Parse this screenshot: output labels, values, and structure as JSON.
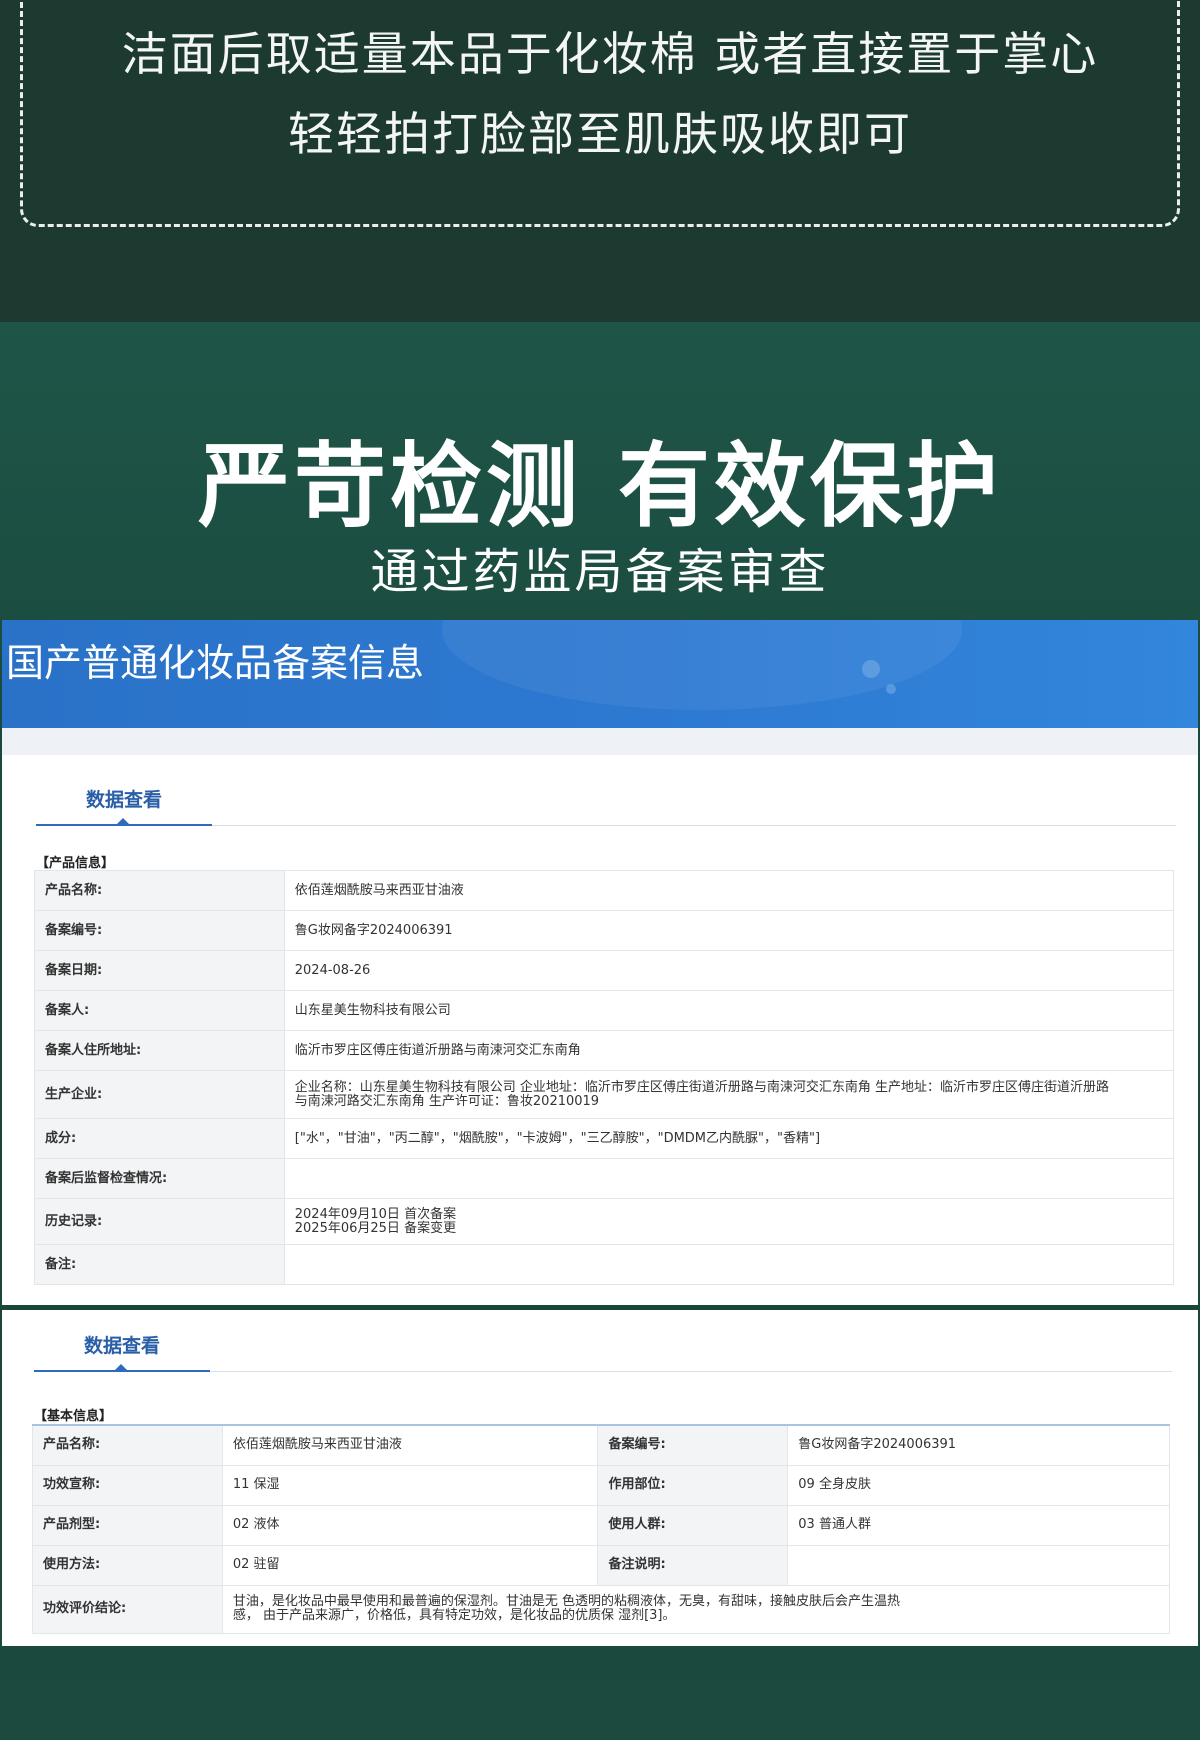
{
  "usage": {
    "line1": "洁面后取适量本品于化妆棉 或者直接置于掌心",
    "line2": "轻轻拍打脸部至肌肤吸收即可"
  },
  "inspection": {
    "title": "严苛检测 有效保护",
    "subtitle": "通过药监局备案审查"
  },
  "registry": {
    "banner_title": "国产普通化妆品备案信息",
    "tab_label": "数据查看",
    "product_section": "【产品信息】",
    "product_rows": [
      {
        "label": "产品名称:",
        "value": "依佰莲烟酰胺马来西亚甘油液"
      },
      {
        "label": "备案编号:",
        "value": "鲁G妆网备字2024006391"
      },
      {
        "label": "备案日期:",
        "value": "2024-08-26"
      },
      {
        "label": "备案人:",
        "value": "山东星美生物科技有限公司"
      },
      {
        "label": "备案人住所地址:",
        "value": "临沂市罗庄区傅庄街道沂册路与南涑河交汇东南角"
      },
      {
        "label": "生产企业:",
        "value": "企业名称：山东星美生物科技有限公司 企业地址：临沂市罗庄区傅庄街道沂册路与南涑河交汇东南角 生产地址：临沂市罗庄区傅庄街道沂册路与南涑河路交汇东南角 生产许可证：鲁妆20210019"
      },
      {
        "label": "成分:",
        "value": "[\"水\"，\"甘油\"，\"丙二醇\"，\"烟酰胺\"，\"卡波姆\"，\"三乙醇胺\"，\"DMDM乙内酰脲\"，\"香精\"]"
      },
      {
        "label": "备案后监督检查情况:",
        "value": ""
      },
      {
        "label": "历史记录:",
        "value_line1": "2024年09月10日 首次备案",
        "value_line2": "2025年06月25日 备案变更"
      },
      {
        "label": "备注:",
        "value": ""
      }
    ]
  },
  "registry2": {
    "tab_label": "数据查看",
    "basic_section": "【基本信息】",
    "rows": [
      {
        "k1": "产品名称:",
        "v1": "依佰莲烟酰胺马来西亚甘油液",
        "k2": "备案编号:",
        "v2": "鲁G妆网备字2024006391"
      },
      {
        "k1": "功效宣称:",
        "v1": "11 保湿",
        "k2": "作用部位:",
        "v2": "09 全身皮肤"
      },
      {
        "k1": "产品剂型:",
        "v1": "02 液体",
        "k2": "使用人群:",
        "v2": "03 普通人群"
      },
      {
        "k1": "使用方法:",
        "v1": "02 驻留",
        "k2": "备注说明:",
        "v2": ""
      }
    ],
    "conclusion_label": "功效评价结论:",
    "conclusion_line1": "甘油，是化妆品中最早使用和最普遍的保湿剂。甘油是无 色透明的粘稠液体，无臭，有甜味，接触皮肤后会产生温热",
    "conclusion_line2": "感， 由于产品来源广，价格低，具有特定功效，是化妆品的优质保 湿剂[3]。"
  },
  "colors": {
    "top_bg": "#1d3a31",
    "mid_bg": "#1e5548",
    "banner_blue": "#2d79d2",
    "tab_blue": "#2a5fa8"
  }
}
